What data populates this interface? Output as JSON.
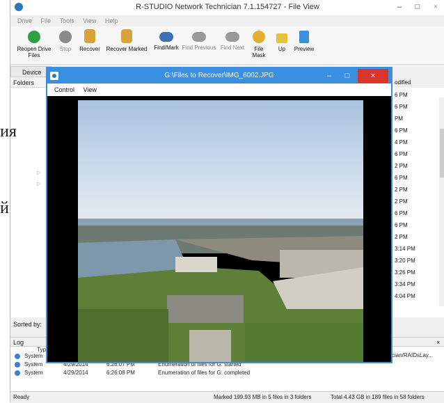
{
  "app": {
    "title": "R-STUDIO Network Technician 7.1.154727 - File View",
    "window_controls": {
      "minimize": "–",
      "maximize": "□",
      "close": "×"
    }
  },
  "menu": [
    "Drive",
    "File",
    "Tools",
    "View",
    "Help"
  ],
  "toolbar": [
    {
      "label": "Reopen Drive Files",
      "icon": "refresh-icon",
      "color": "#2ea043"
    },
    {
      "label": "Stop",
      "icon": "stop-icon",
      "color": "#8a8a8a"
    },
    {
      "label": "Recover",
      "icon": "recover-icon",
      "color": "#d8a43a"
    },
    {
      "label": "Recover Marked",
      "icon": "recover-marked-icon",
      "color": "#d8a43a"
    },
    {
      "label": "Find/Mark",
      "icon": "binoculars-icon",
      "color": "#3b6fb6"
    },
    {
      "label": "Find Previous",
      "icon": "binoculars-prev-icon",
      "color": "#9a9a9a"
    },
    {
      "label": "Find Next",
      "icon": "binoculars-next-icon",
      "color": "#9a9a9a"
    },
    {
      "label": "File Mask",
      "icon": "file-mask-icon",
      "color": "#e0b030"
    },
    {
      "label": "Up",
      "icon": "up-folder-icon",
      "color": "#e8c23a"
    },
    {
      "label": "Preview",
      "icon": "preview-icon",
      "color": "#3b8fe0"
    }
  ],
  "left": {
    "device_tab": "Device",
    "folders_header": "Folders",
    "sorted_by": "Sorted by:"
  },
  "right_list": {
    "header": "odified",
    "rows": [
      "6 PM",
      "6 PM",
      "PM",
      "6 PM",
      "4 PM",
      "6 PM",
      "2 PM",
      "6 PM",
      "2 PM",
      "2 PM",
      "6 PM",
      "6 PM",
      "2 PM",
      "3:14 PM",
      "3:20 PM",
      "3:26 PM",
      "3:34 PM",
      "4:04 PM"
    ]
  },
  "background_fragments": [
    "ия",
    "й"
  ],
  "viewer": {
    "title": "G:\\Files to Recover\\IMG_6002.JPG",
    "menu": [
      "Control",
      "View"
    ],
    "photo": {
      "sky": "#c6d8ec",
      "water": "#7d98ab",
      "park": "#5e7f38"
    }
  },
  "log": {
    "title": "Log",
    "type_header": "Type",
    "path_fragment": "cian/RAIDsLay...",
    "rows": [
      {
        "type": "System",
        "date": "",
        "time": "",
        "text": ""
      },
      {
        "type": "System",
        "date": "4/29/2014",
        "time": "6:26:07 PM",
        "text": "Enumeration of files for G: started"
      },
      {
        "type": "System",
        "date": "4/29/2014",
        "time": "6:26:08 PM",
        "text": "Enumeration of files for G: completed"
      }
    ]
  },
  "status": {
    "left": "Ready",
    "marked": "Marked 199.93 MB in 5 files in 3 folders",
    "total": "Total 4.43 GB in 189 files in 58 folders"
  }
}
